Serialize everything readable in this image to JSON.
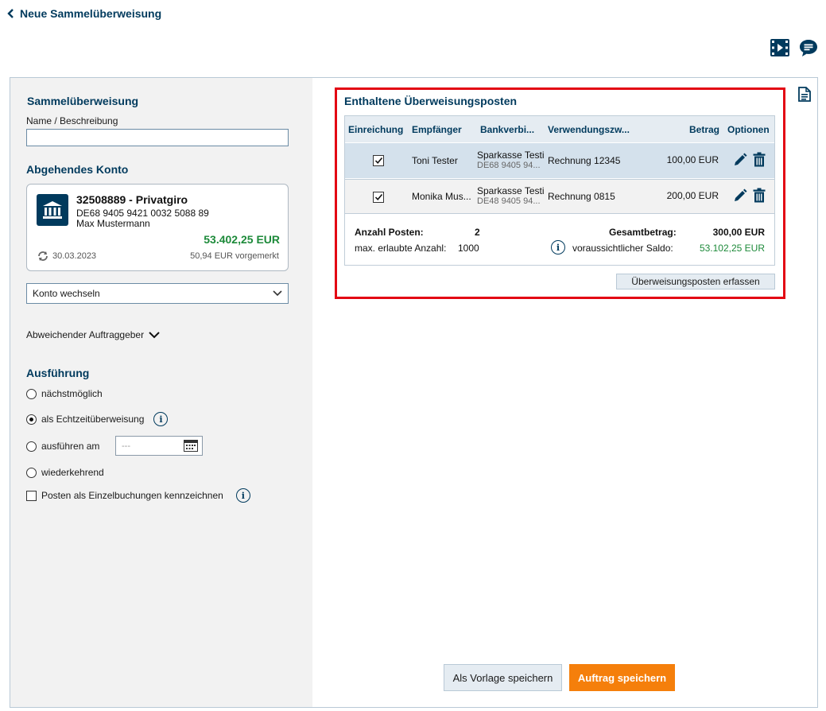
{
  "header": {
    "title": "Neue Sammelüberweisung",
    "icons": [
      "chevron-left-icon",
      "video-icon",
      "chat-icon",
      "document-icon"
    ]
  },
  "left": {
    "sammel_title": "Sammelüberweisung",
    "name_label": "Name / Beschreibung",
    "name_value": "",
    "konto_title": "Abgehendes Konto",
    "account": {
      "name": "32508889 - Privatgiro",
      "iban": "DE68 9405 9421 0032 5088 89",
      "owner": "Max Mustermann",
      "balance": "53.402,25 EUR",
      "date": "30.03.2023",
      "reserved": "50,94 EUR vorgemerkt"
    },
    "konto_select": "Konto wechseln",
    "abweichend": "Abweichender Auftraggeber",
    "ausfuehrung_title": "Ausführung",
    "options": {
      "naechst": "nächstmöglich",
      "echtzeit": "als Echtzeitüberweisung",
      "ausfuehren": "ausführen am",
      "date_placeholder": "---",
      "wiederkehrend": "wiederkehrend",
      "einzel": "Posten als Einzelbuchungen kennzeichnen"
    },
    "selected_option": "echtzeit"
  },
  "posten": {
    "title": "Enthaltene Überweisungsposten",
    "columns": [
      "Einreichung",
      "Empfänger",
      "Bankverbi...",
      "Verwendungszw...",
      "Betrag",
      "Optionen"
    ],
    "rows": [
      {
        "checked": true,
        "empfaenger": "Toni Tester",
        "bank": "Sparkasse Testi",
        "iban": "DE68 9405 94...",
        "zweck": "Rechnung 12345",
        "betrag": "100,00 EUR"
      },
      {
        "checked": true,
        "empfaenger": "Monika Mus...",
        "bank": "Sparkasse Testi",
        "iban": "DE48 9405 94...",
        "zweck": "Rechnung 0815",
        "betrag": "200,00 EUR"
      }
    ],
    "summary": {
      "anzahl_label": "Anzahl Posten:",
      "anzahl_value": "2",
      "max_label": "max. erlaubte Anzahl:",
      "max_value": "1000",
      "gesamt_label": "Gesamtbetrag:",
      "gesamt_value": "300,00 EUR",
      "saldo_label": "voraussichtlicher Saldo:",
      "saldo_value": "53.102,25 EUR"
    },
    "add_button": "Überweisungsposten erfassen"
  },
  "actions": {
    "vorlage": "Als Vorlage speichern",
    "speichern": "Auftrag speichern"
  },
  "colors": {
    "primary": "#003a5d",
    "accent": "#f57f0b",
    "positive": "#1d8a3a",
    "highlight": "#e30613"
  }
}
